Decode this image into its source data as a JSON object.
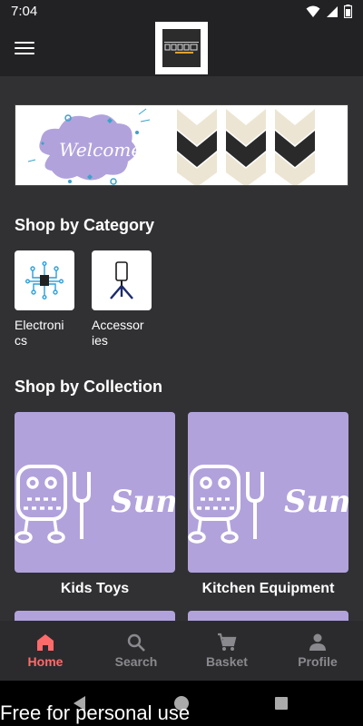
{
  "status_bar": {
    "time": "7:04"
  },
  "header": {
    "logo_alt": "Store logo"
  },
  "banner": {
    "text": "Welcome"
  },
  "sections": {
    "category_title": "Shop by Category",
    "collection_title": "Shop by Collection"
  },
  "categories": [
    {
      "label": "Electronics",
      "icon": "circuit-chip-icon"
    },
    {
      "label": "Accessories",
      "icon": "phone-tripod-icon"
    }
  ],
  "collections": [
    {
      "label": "Kids Toys",
      "overlay_text": "Sum"
    },
    {
      "label": "Kitchen Equipment",
      "overlay_text": "Sum"
    }
  ],
  "bottom_nav": {
    "items": [
      {
        "label": "Home",
        "icon": "home-icon",
        "active": true
      },
      {
        "label": "Search",
        "icon": "search-icon",
        "active": false
      },
      {
        "label": "Basket",
        "icon": "cart-icon",
        "active": false
      },
      {
        "label": "Profile",
        "icon": "person-icon",
        "active": false
      }
    ]
  },
  "colors": {
    "accent": "#ff6b6b",
    "collection_tile": "#b1a2dc",
    "background": "#313134"
  },
  "watermark": "Free for personal use"
}
